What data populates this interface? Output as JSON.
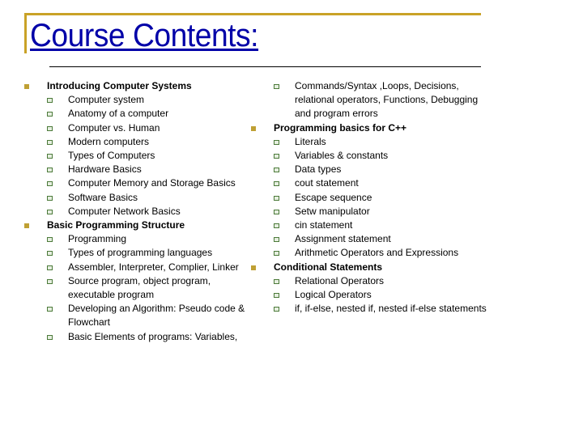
{
  "slide": {
    "title": "Course Contents:",
    "colors": {
      "title": "#0000A8",
      "frame": "#C9A227",
      "level1_bullet": "#BFA034",
      "level2_bullet": "#4C7A3A"
    }
  },
  "left_column": [
    {
      "label": "Introducing Computer Systems",
      "items": [
        "Computer system",
        "Anatomy of a computer",
        "Computer vs. Human",
        "Modern computers",
        "Types of Computers",
        "Hardware Basics",
        "Computer Memory and Storage Basics",
        "Software Basics",
        "Computer Network Basics"
      ]
    },
    {
      "label": "Basic Programming Structure",
      "items": [
        "Programming",
        "Types of  programming languages",
        "Assembler, Interpreter, Complier, Linker",
        "Source program, object program, executable program",
        "Developing an Algorithm: Pseudo code & Flowchart",
        "Basic Elements of programs: Variables,"
      ]
    }
  ],
  "right_column": {
    "continued_item": "Commands/Syntax ,Loops, Decisions, relational operators, Functions, Debugging and program errors",
    "sections": [
      {
        "label": "Programming basics for C++",
        "items": [
          "Literals",
          "Variables & constants",
          "Data types",
          "cout statement",
          "Escape sequence",
          "Setw manipulator",
          "cin statement",
          "Assignment statement",
          "Arithmetic Operators and Expressions"
        ]
      },
      {
        "label": "Conditional Statements",
        "items": [
          "Relational Operators",
          "Logical Operators",
          "if, if-else, nested if, nested if-else statements"
        ]
      }
    ]
  }
}
